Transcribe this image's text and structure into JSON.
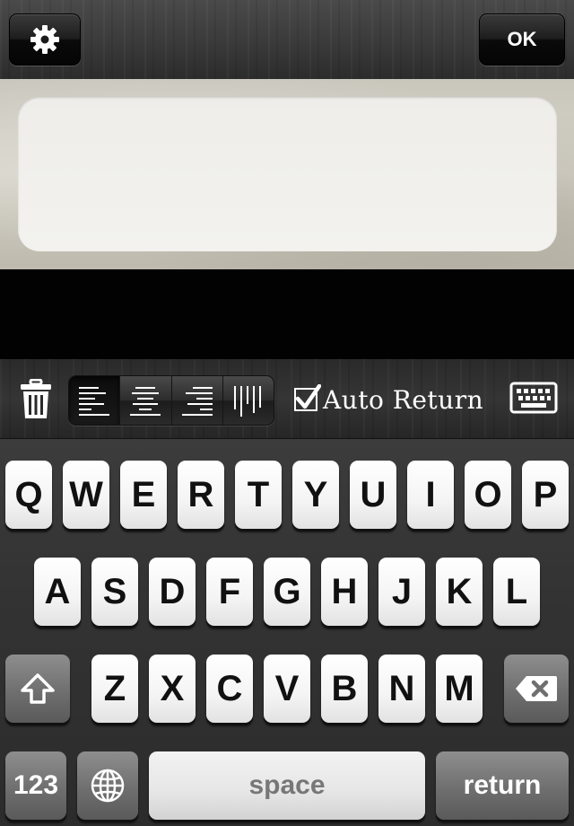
{
  "header": {
    "settings_icon": "gear-icon",
    "ok_label": "OK"
  },
  "editor": {
    "text": ""
  },
  "toolbar": {
    "trash_icon": "trash-icon",
    "alignments": [
      {
        "name": "align-left",
        "icon": "align-left-icon",
        "active": true
      },
      {
        "name": "align-center",
        "icon": "align-center-icon",
        "active": false
      },
      {
        "name": "align-right",
        "icon": "align-right-icon",
        "active": false
      },
      {
        "name": "vertical-text",
        "icon": "vertical-lines-icon",
        "active": false
      }
    ],
    "auto_return": {
      "label": "Auto Return",
      "checked": true
    },
    "keyboard_icon": "keyboard-icon"
  },
  "keyboard": {
    "row1": [
      "Q",
      "W",
      "E",
      "R",
      "T",
      "Y",
      "U",
      "I",
      "O",
      "P"
    ],
    "row2": [
      "A",
      "S",
      "D",
      "F",
      "G",
      "H",
      "J",
      "K",
      "L"
    ],
    "row3": [
      "Z",
      "X",
      "C",
      "V",
      "B",
      "N",
      "M"
    ],
    "numbers_label": "123",
    "space_label": "space",
    "return_label": "return"
  }
}
